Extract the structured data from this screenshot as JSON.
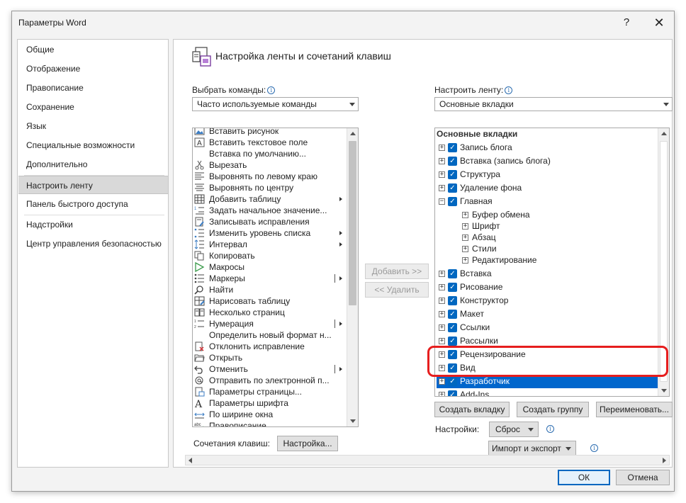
{
  "window": {
    "title": "Параметры Word",
    "help": "?",
    "close": "✕"
  },
  "nav": {
    "items": [
      "Общие",
      "Отображение",
      "Правописание",
      "Сохранение",
      "Язык",
      "Специальные возможности",
      "Дополнительно",
      "Настроить ленту",
      "Панель быстрого доступа",
      "Надстройки",
      "Центр управления безопасностью"
    ],
    "selected": "Настроить ленту"
  },
  "main": {
    "title": "Настройка ленты и сочетаний клавиш",
    "choose_label": "Выбрать команды:",
    "choose_value": "Часто используемые команды",
    "customize_label": "Настроить ленту:",
    "customize_value": "Основные вкладки"
  },
  "commands": [
    {
      "label": "Вставить рисунок",
      "icon": "picture-icon"
    },
    {
      "label": "Вставить текстовое поле",
      "icon": "textbox-icon"
    },
    {
      "label": "Вставка по умолчанию...",
      "icon": "none"
    },
    {
      "label": "Вырезать",
      "icon": "scissors-icon"
    },
    {
      "label": "Выровнять по левому краю",
      "icon": "align-left-icon"
    },
    {
      "label": "Выровнять по центру",
      "icon": "align-center-icon"
    },
    {
      "label": "Добавить таблицу",
      "icon": "table-icon",
      "submenu": true
    },
    {
      "label": "Задать начальное значение...",
      "icon": "numbering-start-icon"
    },
    {
      "label": "Записывать исправления",
      "icon": "track-changes-icon"
    },
    {
      "label": "Изменить уровень списка",
      "icon": "list-level-icon",
      "submenu": true
    },
    {
      "label": "Интервал",
      "icon": "spacing-icon",
      "submenu": true
    },
    {
      "label": "Копировать",
      "icon": "copy-icon"
    },
    {
      "label": "Макросы",
      "icon": "macros-icon"
    },
    {
      "label": "Маркеры",
      "icon": "bullets-icon",
      "split": true
    },
    {
      "label": "Найти",
      "icon": "find-icon"
    },
    {
      "label": "Нарисовать таблицу",
      "icon": "draw-table-icon"
    },
    {
      "label": "Несколько страниц",
      "icon": "multiple-pages-icon"
    },
    {
      "label": "Нумерация",
      "icon": "numbering-icon",
      "split": true
    },
    {
      "label": "Определить новый формат н...",
      "icon": "none"
    },
    {
      "label": "Отклонить исправление",
      "icon": "reject-change-icon"
    },
    {
      "label": "Открыть",
      "icon": "open-folder-icon"
    },
    {
      "label": "Отменить",
      "icon": "undo-icon",
      "split": true
    },
    {
      "label": "Отправить по электронной п...",
      "icon": "email-icon"
    },
    {
      "label": "Параметры страницы...",
      "icon": "page-setup-icon"
    },
    {
      "label": "Параметры шрифта",
      "icon": "font-icon"
    },
    {
      "label": "По ширине окна",
      "icon": "page-width-icon"
    },
    {
      "label": "Правописание",
      "icon": "spelling-icon"
    }
  ],
  "buttons": {
    "add": "Добавить >>",
    "remove": "<< Удалить",
    "shortcuts_label": "Сочетания клавиш:",
    "shortcuts_btn": "Настройка...",
    "new_tab": "Создать вкладку",
    "new_group": "Создать группу",
    "rename": "Переименовать...",
    "settings_label": "Настройки:",
    "reset": "Сброс",
    "import_export": "Импорт и экспорт",
    "ok": "ОК",
    "cancel": "Отмена"
  },
  "tree": {
    "header": "Основные вкладки",
    "rows": [
      {
        "label": "Запись блога",
        "level": 0,
        "checked": true
      },
      {
        "label": "Вставка (запись блога)",
        "level": 0,
        "checked": true
      },
      {
        "label": "Структура",
        "level": 0,
        "checked": true
      },
      {
        "label": "Удаление фона",
        "level": 0,
        "checked": true
      },
      {
        "label": "Главная",
        "level": 0,
        "checked": true,
        "expanded": true
      },
      {
        "label": "Буфер обмена",
        "level": 1
      },
      {
        "label": "Шрифт",
        "level": 1
      },
      {
        "label": "Абзац",
        "level": 1
      },
      {
        "label": "Стили",
        "level": 1
      },
      {
        "label": "Редактирование",
        "level": 1
      },
      {
        "label": "Вставка",
        "level": 0,
        "checked": true
      },
      {
        "label": "Рисование",
        "level": 0,
        "checked": true
      },
      {
        "label": "Конструктор",
        "level": 0,
        "checked": true
      },
      {
        "label": "Макет",
        "level": 0,
        "checked": true
      },
      {
        "label": "Ссылки",
        "level": 0,
        "checked": true
      },
      {
        "label": "Рассылки",
        "level": 0,
        "checked": true
      },
      {
        "label": "Рецензирование",
        "level": 0,
        "checked": true
      },
      {
        "label": "Вид",
        "level": 0,
        "checked": true
      },
      {
        "label": "Разработчик",
        "level": 0,
        "checked": true,
        "selected": true
      },
      {
        "label": "Add-Ins",
        "level": 0,
        "checked": true
      }
    ]
  },
  "colors": {
    "accent": "#0067c0",
    "selection": "#0066cc",
    "highlight": "#e61e1e"
  }
}
